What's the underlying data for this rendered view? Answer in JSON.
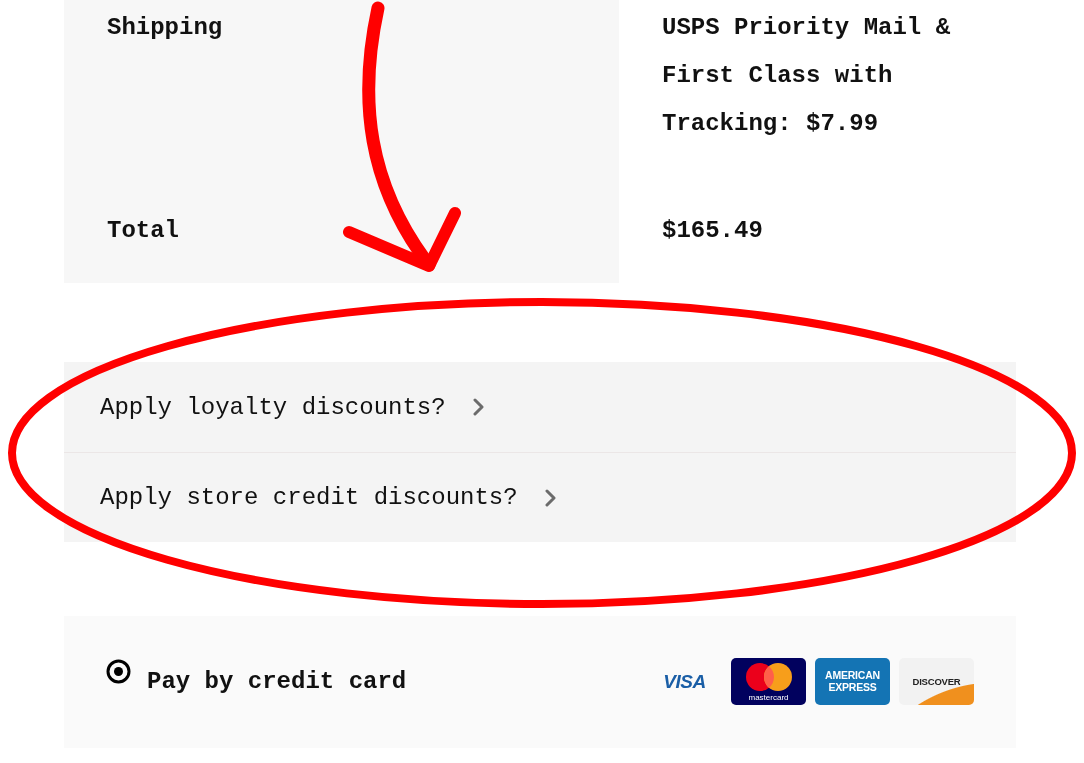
{
  "order_summary": {
    "rows": [
      {
        "label": "Shipping",
        "value": "USPS Priority Mail & First Class with Tracking: $7.99"
      },
      {
        "label": "Total",
        "value": "$165.49"
      }
    ]
  },
  "discounts": [
    {
      "label": "Apply loyalty discounts?"
    },
    {
      "label": "Apply store credit discounts?"
    }
  ],
  "payment_methods": [
    {
      "label": "Pay by credit card",
      "selected": true,
      "cards": [
        {
          "kind": "visa",
          "label": "VISA"
        },
        {
          "kind": "mastercard",
          "label": "mastercard"
        },
        {
          "kind": "amex",
          "label": "AMERICAN EXPRESS"
        },
        {
          "kind": "discover",
          "label": "DISCOVER"
        }
      ]
    }
  ]
}
